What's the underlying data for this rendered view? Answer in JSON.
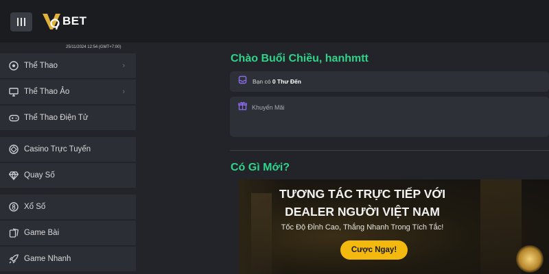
{
  "brand": {
    "name": "BET",
    "mark": "V9"
  },
  "clock": "25/11/2024 12:54 (GMT+7:00)",
  "sidebar": {
    "items": [
      {
        "label": "Thể Thao",
        "icon": "soccer-ball-icon",
        "has_chevron": true
      },
      {
        "label": "Thể Thao Ảo",
        "icon": "monitor-icon",
        "has_chevron": true
      },
      {
        "label": "Thể Thao Điện Tử",
        "icon": "gamepad-icon",
        "has_chevron": false
      },
      {
        "label": "Casino Trực Tuyến",
        "icon": "casino-chip-icon",
        "has_chevron": false
      },
      {
        "label": "Quay Số",
        "icon": "diamond-icon",
        "has_chevron": false
      },
      {
        "label": "Xổ Số",
        "icon": "lottery-ball-icon",
        "has_chevron": false
      },
      {
        "label": "Game Bài",
        "icon": "cards-icon",
        "has_chevron": false
      },
      {
        "label": "Game Nhanh",
        "icon": "rocket-icon",
        "has_chevron": false
      }
    ]
  },
  "main": {
    "greeting": "Chào Buổi Chiều, hanhmtt",
    "mail": {
      "prefix": "Bạn có",
      "count_text": "0 Thư Đến"
    },
    "promo": {
      "label": "Khuyến Mãi"
    },
    "news_title": "Có Gì Mới?",
    "banner": {
      "line1": "TƯƠNG TÁC TRỰC TIẾP VỚI",
      "line2": "DEALER NGƯỜI VIỆT NAM",
      "sub": "Tốc Độ Đỉnh Cao, Thắng Nhanh Trong Tích Tắc!",
      "cta": "Cược Ngay!"
    }
  },
  "colors": {
    "accent_green": "#2fd48a",
    "cta_yellow": "#f3b90e",
    "logo_gold": "#e0b23a"
  }
}
